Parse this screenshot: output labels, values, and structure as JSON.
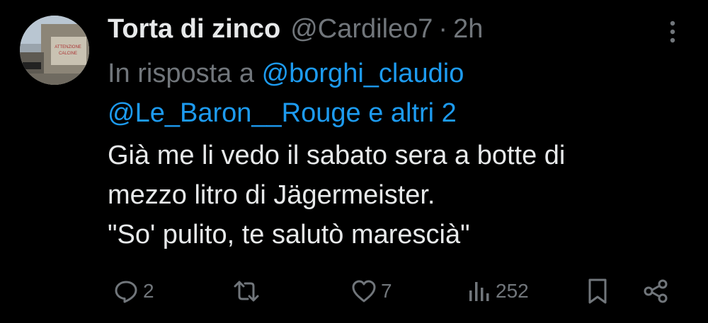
{
  "tweet": {
    "display_name": "Torta di zinco",
    "handle": "@Cardileo7",
    "separator": "·",
    "time": "2h",
    "reply": {
      "prefix": "In risposta a",
      "mention1": "@borghi_claudio",
      "mention2": "@Le_Baron__Rouge",
      "suffix": "e altri 2"
    },
    "text_lines": [
      "Già me li vedo il sabato sera a botte di",
      "mezzo litro di Jägermeister.",
      "\"So' pulito, te salutò marescià\""
    ],
    "avatar_sign_text": [
      "ATTENZIONE",
      "CALCINE"
    ]
  },
  "actions": {
    "reply_count": "2",
    "retweet_count": "",
    "like_count": "7",
    "views_count": "252"
  },
  "icons": {
    "more": "more-vertical-icon",
    "reply": "reply-bubble-icon",
    "retweet": "retweet-icon",
    "like": "heart-icon",
    "views": "views-bar-chart-icon",
    "bookmark": "bookmark-icon",
    "share": "share-icon"
  },
  "colors": {
    "background": "#000000",
    "text": "#e7e9ea",
    "muted": "#71767b",
    "link": "#1d9bf0"
  }
}
